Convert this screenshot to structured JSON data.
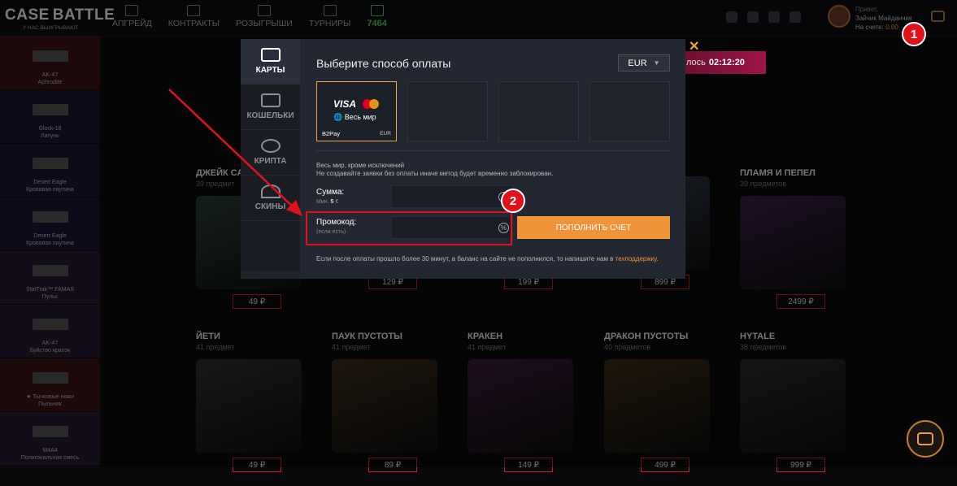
{
  "header": {
    "logo_text": "CASE⬛BATTLE",
    "logo_left": "CASE",
    "logo_right": "BATTLE",
    "logo_sub": "У НАС ВЫИГРЫВАЮТ",
    "nav": [
      {
        "label": "АПГРЕЙД",
        "icon": "upgrade-icon"
      },
      {
        "label": "КОНТРАКТЫ",
        "icon": "contract-icon"
      },
      {
        "label": "РОЗЫГРЫШИ",
        "icon": "gift-icon"
      },
      {
        "label": "ТУРНИРЫ",
        "icon": "medal-icon"
      }
    ],
    "online_count": "7464",
    "user": {
      "greeting": "Привет,",
      "name": "Зайчик Майданчик",
      "balance_label": "На счете:",
      "balance_value": "0.00"
    }
  },
  "badges": {
    "one": "1",
    "two": "2"
  },
  "sidebar": {
    "drops": [
      {
        "name": "AK-47",
        "skin": "Aphrodite",
        "color": "#3a1212"
      },
      {
        "name": "Glock-18",
        "skin": "Латунь",
        "color": "#1f1535"
      },
      {
        "name": "Desert Eagle",
        "skin": "Кровавая паутина",
        "color": "#1f1535"
      },
      {
        "name": "Desert Eagle",
        "skin": "Кровавая паутина",
        "color": "#1f1535"
      },
      {
        "name": "StatTrak™ FAMAS",
        "skin": "Пульс",
        "color": "#241a33"
      },
      {
        "name": "AK-47",
        "skin": "Буйство красок",
        "color": "#241a33"
      },
      {
        "name": "★ Тычковые ножи",
        "skin": "Пыльник",
        "color": "#3a1212"
      },
      {
        "name": "M4A4",
        "skin": "Полигональная смесь",
        "color": "#241a33"
      }
    ]
  },
  "timer": {
    "label": "лось",
    "value": "02:12:20"
  },
  "cases_row1": [
    {
      "name": "ДЖЕЙК СА",
      "count": "39 предмет",
      "price": "49 ₽",
      "color": "#2a3b3a"
    },
    {
      "name": "",
      "count": "",
      "price": "129 ₽",
      "color": "#1e3a44"
    },
    {
      "name": "",
      "count": "",
      "price": "199 ₽",
      "color": "#1d3a26"
    },
    {
      "name": "",
      "count": "",
      "price": "899 ₽",
      "color": "#2f3a4a"
    },
    {
      "name": "ПЛАМЯ И ПЕПЕЛ",
      "count": "39 предметов",
      "price": "2499 ₽",
      "color": "#3a1e4a",
      "new": "NEW"
    }
  ],
  "cases_row2": [
    {
      "name": "ЙЕТИ",
      "count": "41 предмет",
      "price": "49 ₽",
      "color": "#2e2e2e"
    },
    {
      "name": "ПАУК ПУСТОТЫ",
      "count": "41 предмет",
      "price": "89 ₽",
      "color": "#3a2a1a"
    },
    {
      "name": "КРАКЕН",
      "count": "41 предмет",
      "price": "149 ₽",
      "color": "#3a1a3a"
    },
    {
      "name": "ДРАКОН ПУСТОТЫ",
      "count": "40 предметов",
      "price": "499 ₽",
      "color": "#3a2a14"
    },
    {
      "name": "HYTALE",
      "count": "38 предметов",
      "price": "999 ₽",
      "color": "#2a2a2a"
    }
  ],
  "modal": {
    "tabs": [
      {
        "label": "КАРТЫ",
        "icon": "card-icon"
      },
      {
        "label": "КОШЕЛЬКИ",
        "icon": "wallet-icon"
      },
      {
        "label": "КРИПТА",
        "icon": "crypto-icon"
      },
      {
        "label": "СКИНЫ",
        "icon": "skins-icon"
      }
    ],
    "title": "Выберите способ оплаты",
    "currency": "EUR",
    "methods": [
      {
        "brand": "VISA",
        "region": "Весь мир",
        "name": "B2Pay",
        "currency": "EUR"
      }
    ],
    "info_line1": "Весь мир, кроме исключений",
    "info_line2": "Не создавайте заявки без оплаты иначе метод будет временно заблокирован.",
    "amount_label": "Сумма:",
    "amount_hint_prefix": "Мин.",
    "amount_hint_value": "5",
    "amount_hint_suffix": "€",
    "promo_label": "Промокод:",
    "promo_hint": "(если есть)",
    "topup_button": "ПОПОЛНИТЬ СЧЕТ",
    "footer_text": "Если после оплаты прошло более 30 минут, а баланс на сайте не пополнился, то напишите нам в",
    "footer_link": "техподдержку."
  },
  "colors": {
    "accent": "#f19439",
    "highlight": "#e0111b"
  }
}
